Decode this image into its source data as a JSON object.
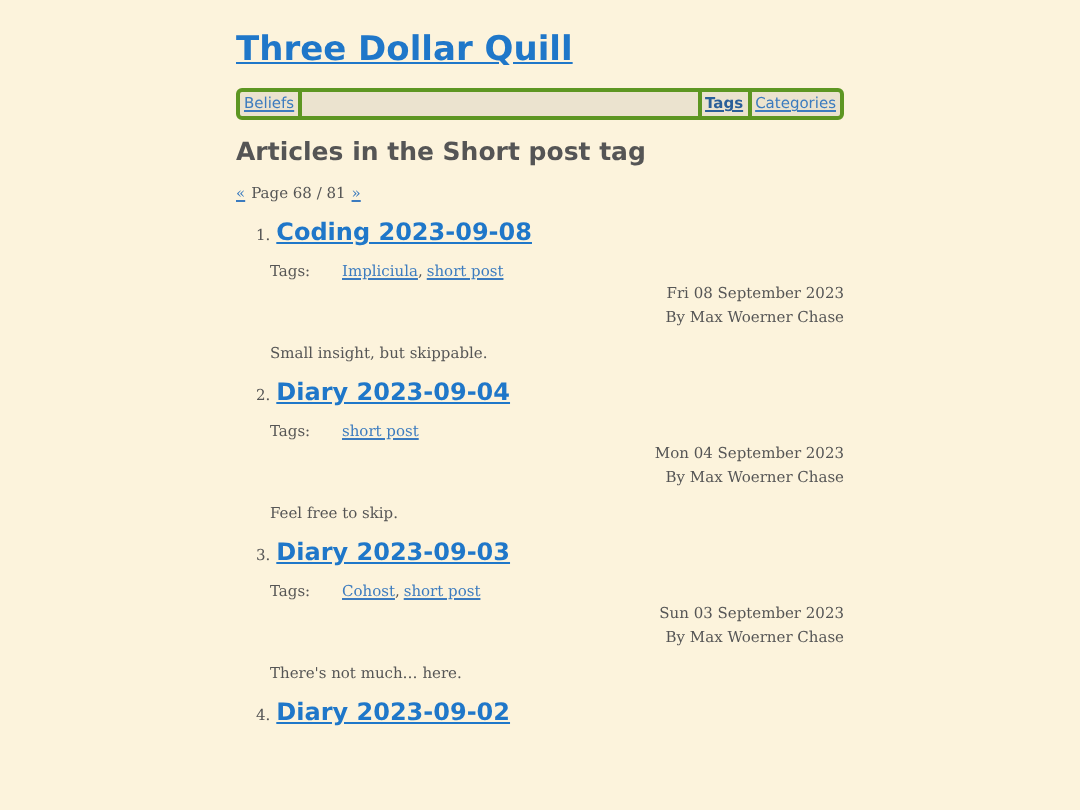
{
  "site_title": "Three Dollar Quill",
  "nav": {
    "left": [
      {
        "label": "Beliefs",
        "selected": false
      }
    ],
    "right": [
      {
        "label": "Tags",
        "selected": true
      },
      {
        "label": "Categories",
        "selected": false
      }
    ]
  },
  "heading": "Articles in the Short post tag",
  "pager": {
    "prev": "«",
    "text": "Page 68 / 81",
    "next": "»"
  },
  "posts": [
    {
      "number": "1.",
      "title": "Coding 2023-09-08",
      "tags_label": "Tags:",
      "tags": [
        {
          "name": "Impliciula",
          "separator": ","
        },
        {
          "name": "short post"
        }
      ],
      "date": "Fri 08 September 2023",
      "author": "By Max Woerner Chase",
      "summary": "Small insight, but skippable."
    },
    {
      "number": "2.",
      "title": "Diary 2023-09-04",
      "tags_label": "Tags:",
      "tags": [
        {
          "name": "short post"
        }
      ],
      "date": "Mon 04 September 2023",
      "author": "By Max Woerner Chase",
      "summary": "Feel free to skip."
    },
    {
      "number": "3.",
      "title": "Diary 2023-09-03",
      "tags_label": "Tags:",
      "tags": [
        {
          "name": "Cohost",
          "separator": ","
        },
        {
          "name": "short post"
        }
      ],
      "date": "Sun 03 September 2023",
      "author": "By Max Woerner Chase",
      "summary": "There's not much… here."
    },
    {
      "number": "4.",
      "title": "Diary 2023-09-02"
    }
  ]
}
